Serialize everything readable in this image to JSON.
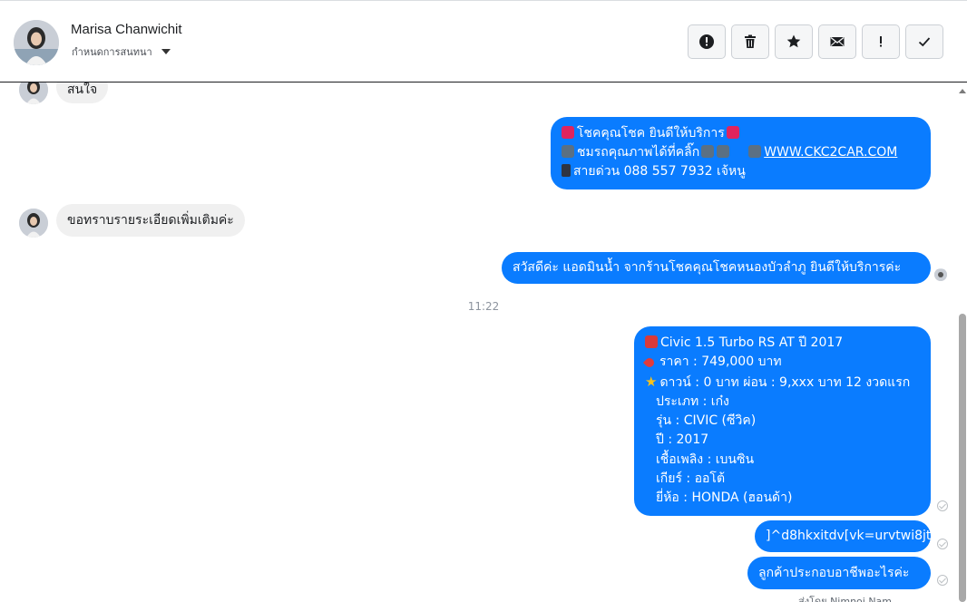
{
  "header": {
    "contact_name": "Marisa Chanwichit",
    "subtitle": "กำหนดการสนทนา",
    "toolbar": [
      {
        "icon": "alert-circle-icon",
        "name": "report-button"
      },
      {
        "icon": "trash-icon",
        "name": "delete-button"
      },
      {
        "icon": "star-icon",
        "name": "star-button"
      },
      {
        "icon": "mail-icon",
        "name": "mark-unread-button"
      },
      {
        "icon": "exclamation-icon",
        "name": "spam-button"
      },
      {
        "icon": "check-icon",
        "name": "mark-done-button"
      }
    ]
  },
  "messages": {
    "m1_text": "สนใจ",
    "m2_line1": "โชคคุณโชค ยินดีให้บริการ",
    "m2_line2a": "ชมรถคุณภาพได้ที่คลิ๊ก",
    "m2_link": "WWW.CKC2CAR.COM",
    "m2_line3": "สายด่วน 088 557 7932 เจ้หนู",
    "m3_text": "ขอทราบรายระเอียดเพิ่มเติมค่ะ",
    "m4_text": "สวัสดีค่ะ แอดมินน้ำ จากร้านโชคคุณโชคหนองบัวลำภู ยินดีให้บริการค่ะ",
    "timestamp": "11:22",
    "m5_lines": [
      "Civic 1.5 Turbo RS AT ปี 2017",
      "ราคา : 749,000 บาท",
      "ดาวน์ : 0 บาท ผ่อน : 9,xxx บาท 12 งวดแรก",
      "ประเภท : เก๋ง",
      "รุ่น : CIVIC (ซีวิค)",
      "ปี : 2017",
      "เชื้อเพลิง : เบนซิน",
      "เกียร์ : ออโต้",
      "ยี่ห้อ : HONDA (ฮอนด้า)"
    ],
    "m6_text": "]^d8hkxitdv[vk=urvtwi8jt",
    "m7_text": "ลูกค้าประกอบอาชีพอะไรค่ะ",
    "footer": "ส่งโดย Nimnoi Nam"
  },
  "colors": {
    "outgoing": "#0a7cff",
    "incoming": "#f0f0f0"
  }
}
